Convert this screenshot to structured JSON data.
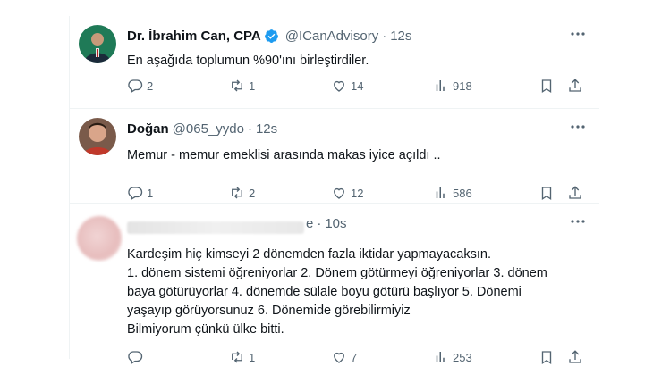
{
  "tweets": [
    {
      "name": "Dr. İbrahim Can, CPA",
      "handle": "@ICanAdvisory",
      "dot": "·",
      "time": "12s",
      "verified": true,
      "text": "En aşağıda toplumun %90'ını birleştirdiler.",
      "replies": "2",
      "retweets": "1",
      "likes": "14",
      "views": "918"
    },
    {
      "name": "Doğan",
      "handle": "@065_yydo",
      "dot": "·",
      "time": "12s",
      "text": "Memur - memur emeklisi arasında makas iyice açıldı ..",
      "replies": "1",
      "retweets": "2",
      "likes": "12",
      "views": "586"
    },
    {
      "name_tail": "e",
      "dot": "·",
      "time": "10s",
      "lines": [
        "Kardeşim hiç kimseyi 2 dönemden fazla iktidar yapmayacaksın.",
        "1. dönem sistemi öğreniyorlar 2. Dönem götürmeyi öğreniyorlar 3. dönem",
        "baya götürüyorlar 4. dönemde sülale boyu götürü başlıyor 5. Dönemi",
        "yaşayıp görüyorsunuz 6. Dönemide görebilirmiyiz",
        "Bilmiyorum çünkü ülke bitti."
      ],
      "replies": "",
      "retweets": "1",
      "likes": "7",
      "views": "253"
    }
  ],
  "colors": {
    "secondary_text": "#536471",
    "verified": "#1d9bf0",
    "divider": "#eff3f4"
  },
  "icons": [
    "reply-icon",
    "retweet-icon",
    "like-icon",
    "views-icon",
    "bookmark-icon",
    "share-icon",
    "more-icon",
    "verified-icon"
  ]
}
